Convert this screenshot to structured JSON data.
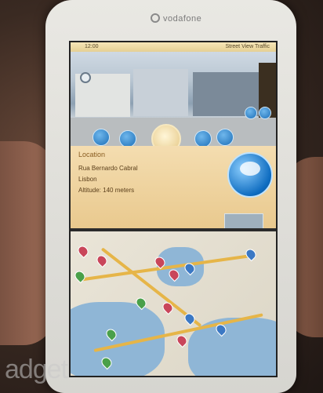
{
  "device": {
    "brand": "vodafone"
  },
  "statusbar": {
    "time": "12:00",
    "right_text": "Street View  Traffic"
  },
  "info": {
    "name": "Location",
    "lines": [
      "Rua Bernardo Cabral",
      "Lisbon",
      "Altitude: 140 meters"
    ]
  },
  "watermark": "adget",
  "colors": {
    "panel_bg": "#f4ddb0",
    "accent_blue": "#1d6fb8",
    "map_water": "#8fb6d6",
    "map_road": "#e6b548"
  }
}
